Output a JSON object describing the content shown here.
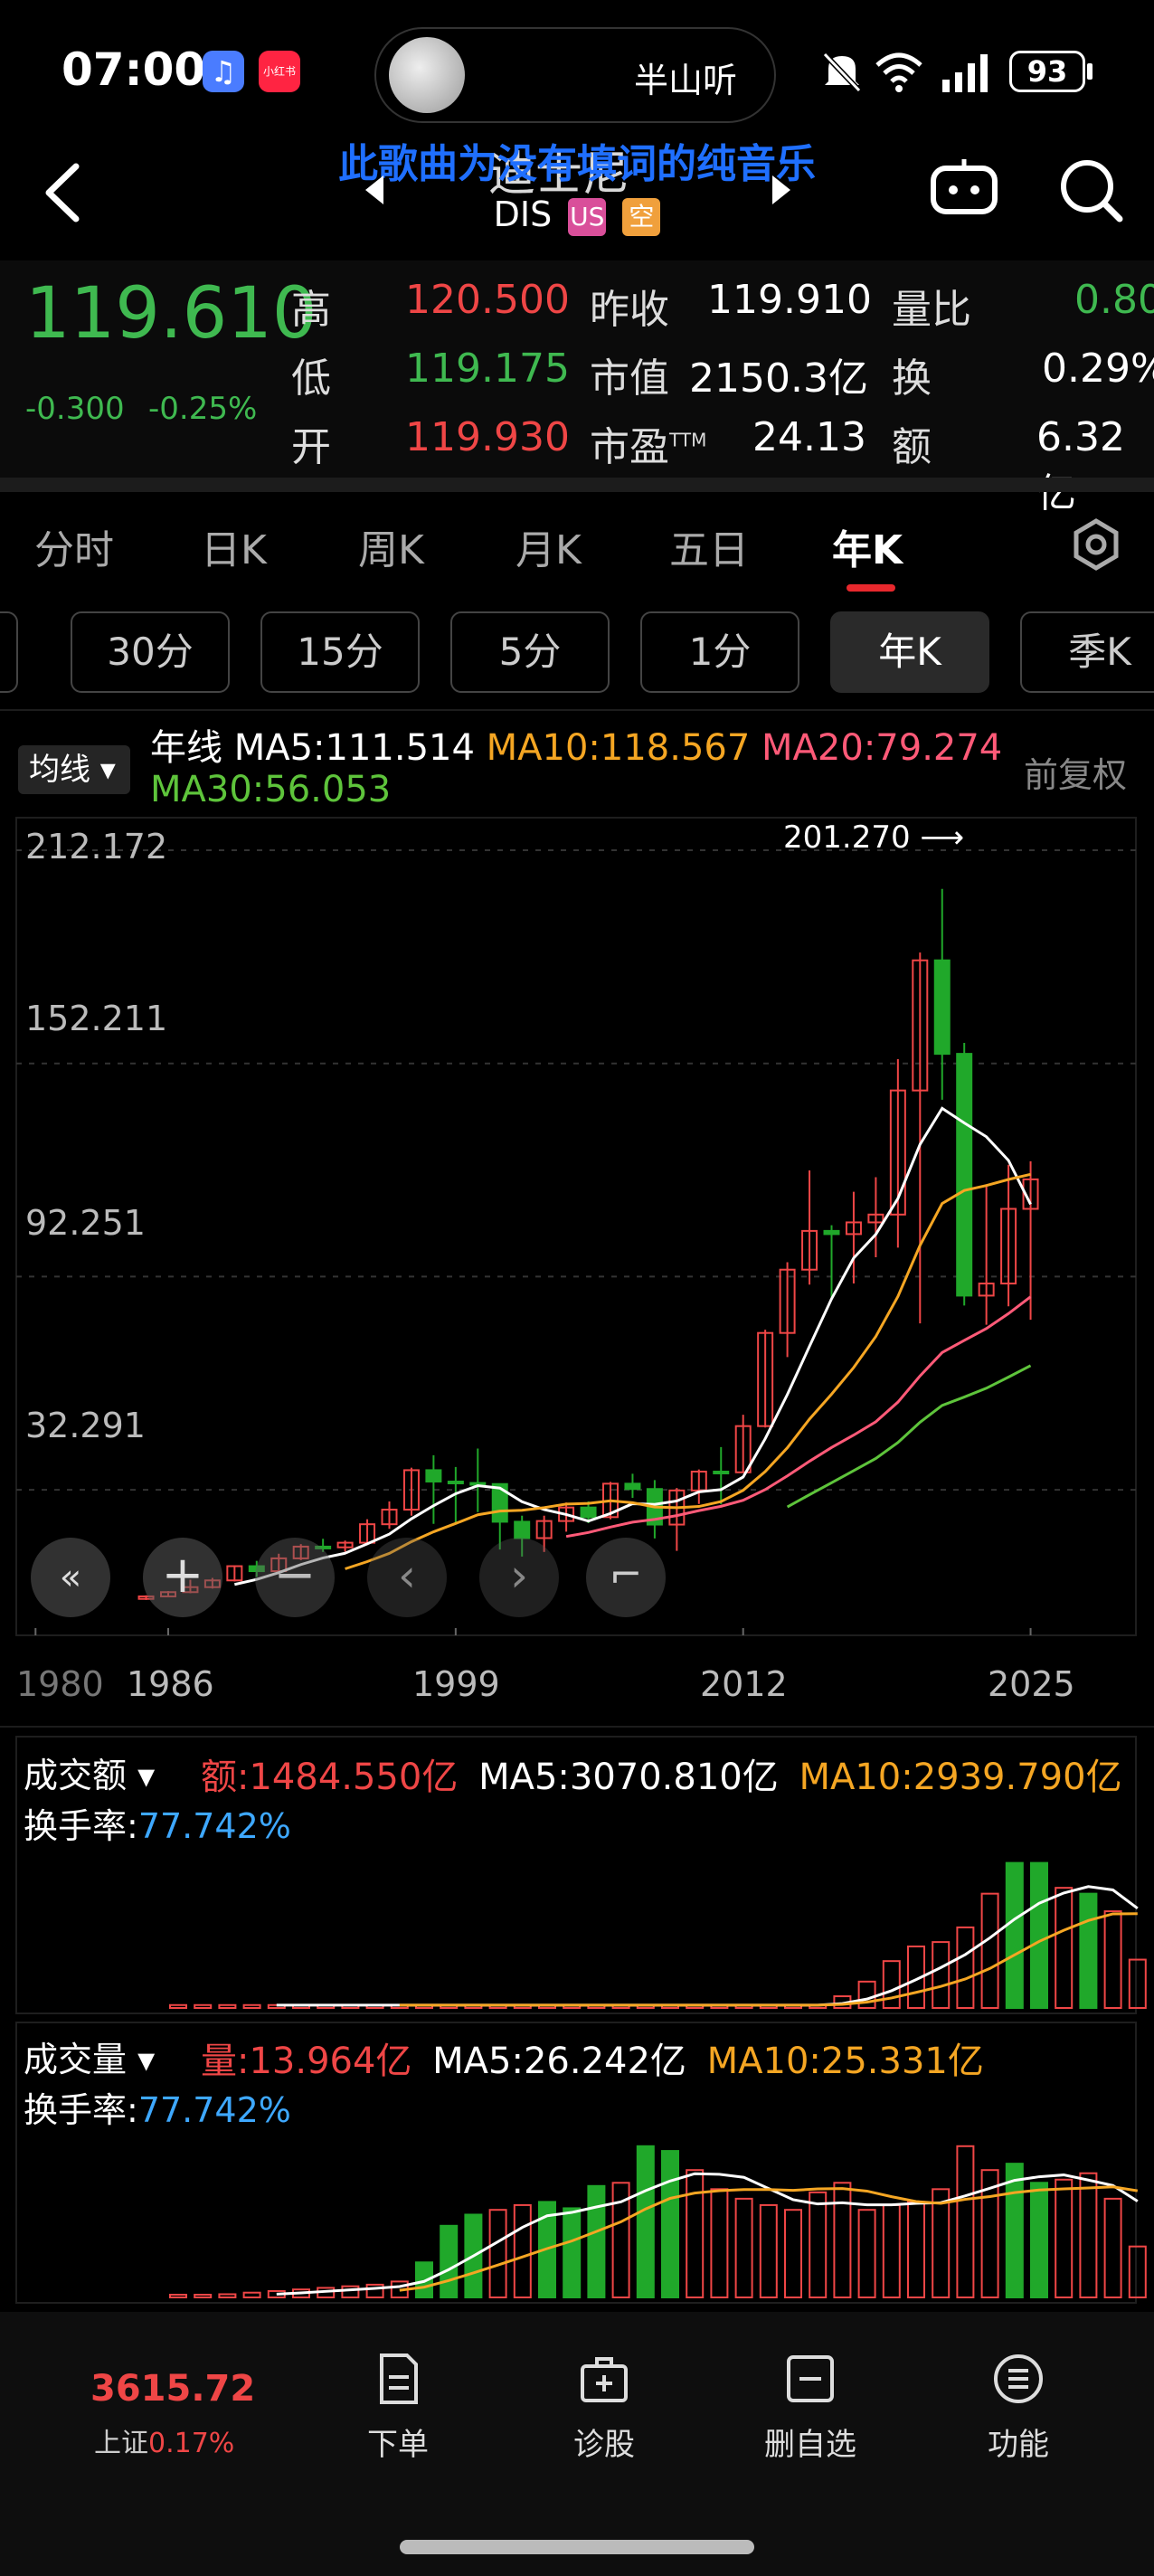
{
  "status_bar": {
    "time": "07:00",
    "music_title": "半山听",
    "battery": "93",
    "music_icon": "music-app-icon",
    "xhs_icon": "xiaohongshu-icon",
    "xhs_label": "小红书"
  },
  "header": {
    "overlay_lyric": "此歌曲为没有填词的纯音乐",
    "title_partial": "迪士尼",
    "ticker": "DIS",
    "market_tag": "US",
    "short_tag": "空"
  },
  "quote": {
    "price": "119.610",
    "change": "-0.300",
    "change_pct": "-0.25%",
    "rows": [
      {
        "l1": "高",
        "v1": "120.500",
        "l2": "昨收",
        "v2": "119.910",
        "l3": "量比",
        "v3": "0.80"
      },
      {
        "l1": "低",
        "v1": "119.175",
        "l2": "市值",
        "v2": "2150.3亿",
        "l3": "换",
        "v3": "0.29%"
      },
      {
        "l1": "开",
        "v1": "119.930",
        "l2": "市盈",
        "v2": "24.13",
        "l3": "额",
        "v3": "6.32亿"
      }
    ],
    "pe_sup": "TTM"
  },
  "tabs": [
    "分时",
    "日K",
    "周K",
    "月K",
    "五日",
    "年K"
  ],
  "active_tab": "年K",
  "period_pills": [
    "30分",
    "15分",
    "5分",
    "1分",
    "年K",
    "季K"
  ],
  "active_pill": "年K",
  "ma_legend": {
    "selector": "均线",
    "line_label": "年线",
    "ma5": "MA5:111.514",
    "ma10": "MA10:118.567",
    "ma20": "MA20:79.274",
    "ma30": "MA30:56.053",
    "adjust": "前复权"
  },
  "chart_data": [
    {
      "type": "candlestick",
      "y_ticks": [
        "212.172",
        "152.211",
        "92.251",
        "32.291"
      ],
      "x_ticks": [
        "1980",
        "1986",
        "1999",
        "2012",
        "2025"
      ],
      "annotation_high": "201.270",
      "ylim": [
        0,
        212.172
      ],
      "candles": [
        {
          "year": 1985,
          "open": 1.6,
          "high": 2.6,
          "low": 1.3,
          "close": 2.3
        },
        {
          "year": 1986,
          "open": 2.3,
          "high": 3.8,
          "low": 2.1,
          "close": 3.5
        },
        {
          "year": 1987,
          "open": 3.5,
          "high": 7.0,
          "low": 3.2,
          "close": 4.9
        },
        {
          "year": 1988,
          "open": 4.9,
          "high": 7.5,
          "low": 4.5,
          "close": 6.8
        },
        {
          "year": 1989,
          "open": 6.8,
          "high": 11.0,
          "low": 6.5,
          "close": 10.8
        },
        {
          "year": 1990,
          "open": 10.8,
          "high": 12.3,
          "low": 7.8,
          "close": 9.4
        },
        {
          "year": 1991,
          "open": 9.4,
          "high": 14.3,
          "low": 9.0,
          "close": 13.0
        },
        {
          "year": 1992,
          "open": 13.0,
          "high": 17.0,
          "low": 12.5,
          "close": 16.3
        },
        {
          "year": 1993,
          "open": 16.3,
          "high": 18.5,
          "low": 14.8,
          "close": 16.1
        },
        {
          "year": 1994,
          "open": 16.1,
          "high": 18.0,
          "low": 14.9,
          "close": 17.4
        },
        {
          "year": 1995,
          "open": 17.4,
          "high": 24.0,
          "low": 17.0,
          "close": 22.6
        },
        {
          "year": 1996,
          "open": 22.6,
          "high": 29.0,
          "low": 21.3,
          "close": 26.7
        },
        {
          "year": 1997,
          "open": 26.7,
          "high": 38.5,
          "low": 25.0,
          "close": 37.8
        },
        {
          "year": 1998,
          "open": 37.8,
          "high": 42.0,
          "low": 22.7,
          "close": 34.6
        },
        {
          "year": 1999,
          "open": 34.6,
          "high": 38.7,
          "low": 23.0,
          "close": 34.2
        },
        {
          "year": 2000,
          "open": 34.2,
          "high": 43.9,
          "low": 26.0,
          "close": 33.9
        },
        {
          "year": 2001,
          "open": 33.9,
          "high": 34.0,
          "low": 15.5,
          "close": 23.3
        },
        {
          "year": 2002,
          "open": 23.3,
          "high": 25.0,
          "low": 13.5,
          "close": 18.7
        },
        {
          "year": 2003,
          "open": 18.7,
          "high": 25.0,
          "low": 14.8,
          "close": 23.5
        },
        {
          "year": 2004,
          "open": 23.5,
          "high": 28.7,
          "low": 20.5,
          "close": 27.3
        },
        {
          "year": 2005,
          "open": 27.3,
          "high": 29.0,
          "low": 22.9,
          "close": 24.6
        },
        {
          "year": 2006,
          "open": 24.6,
          "high": 34.5,
          "low": 24.0,
          "close": 34.0
        },
        {
          "year": 2007,
          "open": 34.0,
          "high": 36.8,
          "low": 30.0,
          "close": 32.5
        },
        {
          "year": 2008,
          "open": 32.5,
          "high": 35.0,
          "low": 18.6,
          "close": 22.5
        },
        {
          "year": 2009,
          "open": 22.5,
          "high": 32.8,
          "low": 15.1,
          "close": 32.1
        },
        {
          "year": 2010,
          "open": 32.1,
          "high": 38.0,
          "low": 28.3,
          "close": 37.4
        },
        {
          "year": 2011,
          "open": 37.4,
          "high": 44.3,
          "low": 28.2,
          "close": 37.2
        },
        {
          "year": 2012,
          "open": 37.2,
          "high": 53.4,
          "low": 37.0,
          "close": 50.2
        },
        {
          "year": 2013,
          "open": 50.2,
          "high": 77.3,
          "low": 49.8,
          "close": 76.4
        },
        {
          "year": 2014,
          "open": 76.4,
          "high": 96.3,
          "low": 69.6,
          "close": 94.2
        },
        {
          "year": 2015,
          "open": 94.2,
          "high": 122.1,
          "low": 90.0,
          "close": 105.1
        },
        {
          "year": 2016,
          "open": 105.1,
          "high": 106.7,
          "low": 86.3,
          "close": 104.2
        },
        {
          "year": 2017,
          "open": 104.2,
          "high": 116.1,
          "low": 90.3,
          "close": 107.5
        },
        {
          "year": 2018,
          "open": 107.5,
          "high": 120.2,
          "low": 97.7,
          "close": 109.7
        },
        {
          "year": 2019,
          "open": 109.7,
          "high": 153.4,
          "low": 100.4,
          "close": 144.6
        },
        {
          "year": 2020,
          "open": 144.6,
          "high": 183.4,
          "low": 79.1,
          "close": 181.2
        },
        {
          "year": 2021,
          "open": 181.2,
          "high": 201.3,
          "low": 142.0,
          "close": 154.9
        },
        {
          "year": 2022,
          "open": 154.9,
          "high": 158.0,
          "low": 84.1,
          "close": 86.9
        },
        {
          "year": 2023,
          "open": 86.9,
          "high": 118.2,
          "low": 78.7,
          "close": 90.3
        },
        {
          "year": 2024,
          "open": 90.3,
          "high": 123.7,
          "low": 83.9,
          "close": 111.3
        },
        {
          "year": 2025,
          "open": 111.3,
          "high": 124.7,
          "low": 80.1,
          "close": 119.6
        }
      ],
      "ma_series": [
        {
          "name": "MA5",
          "color": "#ffffff"
        },
        {
          "name": "MA10",
          "color": "#f5a623"
        },
        {
          "name": "MA20",
          "color": "#ff5a78"
        },
        {
          "name": "MA30",
          "color": "#5ec43b"
        }
      ]
    },
    {
      "type": "bar",
      "title": "成交额",
      "value_label": "额:1484.550亿",
      "ma5": "MA5:3070.810亿",
      "ma10": "MA10:2939.790亿",
      "turnover_label": "换手率:",
      "turnover_value": "77.742%",
      "values": [
        0.02,
        0.02,
        0.02,
        0.02,
        0.02,
        0.02,
        0.02,
        0.02,
        0.02,
        0.02,
        0.02,
        0.02,
        0.02,
        0.02,
        0.02,
        0.02,
        0.02,
        0.02,
        0.02,
        0.02,
        0.02,
        0.02,
        0.02,
        0.02,
        0.02,
        0.02,
        0.02,
        0.08,
        0.18,
        0.32,
        0.42,
        0.45,
        0.55,
        0.78,
        0.99,
        0.99,
        0.82,
        0.78,
        0.66,
        0.33
      ],
      "colors": [
        "r",
        "r",
        "r",
        "r",
        "r",
        "r",
        "r",
        "r",
        "r",
        "r",
        "r",
        "r",
        "r",
        "r",
        "r",
        "r",
        "r",
        "r",
        "r",
        "r",
        "r",
        "r",
        "r",
        "r",
        "r",
        "r",
        "r",
        "r",
        "r",
        "r",
        "r",
        "r",
        "r",
        "r",
        "g",
        "g",
        "r",
        "g",
        "r",
        "r"
      ]
    },
    {
      "type": "bar",
      "title": "成交量",
      "value_label": "量:13.964亿",
      "ma5": "MA5:26.242亿",
      "ma10": "MA10:25.331亿",
      "turnover_label": "换手率:",
      "turnover_value": "77.742%",
      "values": [
        0.01,
        0.01,
        0.02,
        0.03,
        0.04,
        0.05,
        0.06,
        0.07,
        0.08,
        0.1,
        0.22,
        0.45,
        0.52,
        0.55,
        0.58,
        0.6,
        0.56,
        0.7,
        0.72,
        0.95,
        0.92,
        0.8,
        0.68,
        0.62,
        0.58,
        0.55,
        0.66,
        0.72,
        0.55,
        0.58,
        0.6,
        0.68,
        0.95,
        0.8,
        0.84,
        0.72,
        0.74,
        0.78,
        0.62,
        0.32
      ],
      "colors": [
        "r",
        "r",
        "r",
        "r",
        "r",
        "r",
        "r",
        "r",
        "r",
        "r",
        "g",
        "g",
        "g",
        "r",
        "r",
        "g",
        "g",
        "g",
        "r",
        "g",
        "g",
        "r",
        "r",
        "r",
        "r",
        "r",
        "r",
        "r",
        "r",
        "r",
        "r",
        "r",
        "r",
        "r",
        "g",
        "g",
        "r",
        "r",
        "r",
        "r"
      ]
    }
  ],
  "bottom": {
    "index_value": "3615.72",
    "index_name": "上证",
    "index_change": "0.17%",
    "items": [
      "下单",
      "诊股",
      "删自选",
      "功能"
    ]
  }
}
